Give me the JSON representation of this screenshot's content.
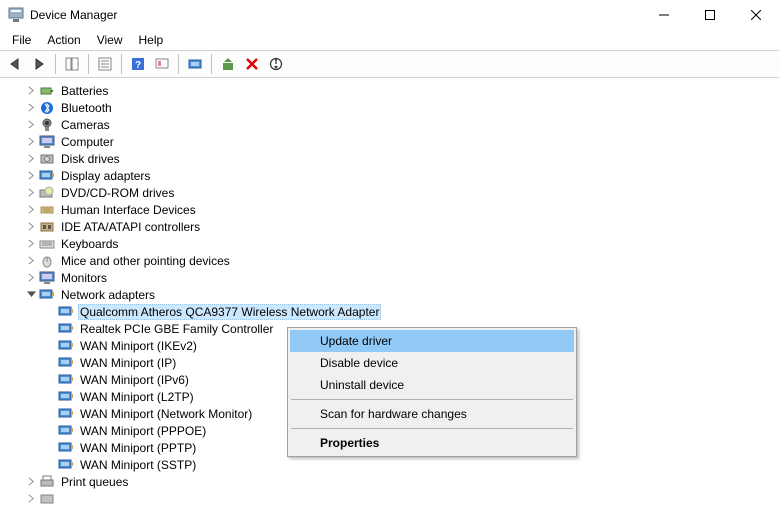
{
  "window": {
    "title": "Device Manager"
  },
  "menu": {
    "file": "File",
    "action": "Action",
    "view": "View",
    "help": "Help"
  },
  "tree": {
    "batteries": "Batteries",
    "bluetooth": "Bluetooth",
    "cameras": "Cameras",
    "computer": "Computer",
    "disk": "Disk drives",
    "display": "Display adapters",
    "dvd": "DVD/CD-ROM drives",
    "hid": "Human Interface Devices",
    "ide": "IDE ATA/ATAPI controllers",
    "keyboards": "Keyboards",
    "mice": "Mice and other pointing devices",
    "monitors": "Monitors",
    "network": "Network adapters",
    "net_items": [
      "Qualcomm Atheros QCA9377 Wireless Network Adapter",
      "Realtek PCIe GBE Family Controller",
      "WAN Miniport (IKEv2)",
      "WAN Miniport (IP)",
      "WAN Miniport (IPv6)",
      "WAN Miniport (L2TP)",
      "WAN Miniport (Network Monitor)",
      "WAN Miniport (PPPOE)",
      "WAN Miniport (PPTP)",
      "WAN Miniport (SSTP)"
    ],
    "print": "Print queues"
  },
  "context": {
    "update": "Update driver",
    "disable": "Disable device",
    "uninstall": "Uninstall device",
    "scan": "Scan for hardware changes",
    "properties": "Properties"
  }
}
